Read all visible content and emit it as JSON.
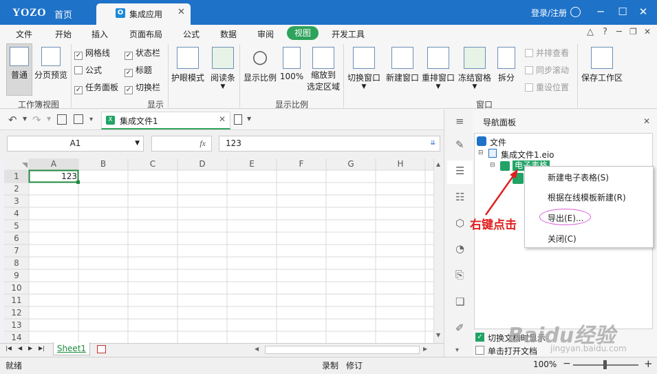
{
  "titlebar": {
    "logo": "YOZO",
    "home": "首页",
    "active_tab": "集成应用",
    "login": "登录/注册"
  },
  "menu": [
    "文件",
    "开始",
    "插入",
    "页面布局",
    "公式",
    "数据",
    "审阅",
    "视图",
    "开发工具"
  ],
  "ribbon": {
    "normal": "普通",
    "page_preview": "分页预览",
    "cb_gridlines": "网格线",
    "cb_formula": "公式",
    "cb_taskpane": "任务面板",
    "cb_statusbar": "状态栏",
    "cb_title": "标题",
    "cb_switch": "切换栏",
    "eye_mode": "护眼模式",
    "reading": "阅读条",
    "zoom": "显示比例",
    "zoom100": "100%",
    "zoom_sel_1": "缩放到",
    "zoom_sel_2": "选定区域",
    "switch_win": "切换窗口",
    "new_win": "新建窗口",
    "arrange": "重排窗口",
    "freeze": "冻结窗格",
    "split": "拆分",
    "side_by_side": "并排查看",
    "sync_scroll": "同步滚动",
    "reset_pos": "重设位置",
    "save_ws": "保存工作区",
    "g_workbook_view": "工作簿视图",
    "g_show": "显示",
    "g_zoom": "显示比例",
    "g_window": "窗口"
  },
  "doc_tab": "集成文件1",
  "formula": {
    "cell_ref": "A1",
    "fx": "fx",
    "value": "123"
  },
  "grid": {
    "columns": [
      "A",
      "B",
      "C",
      "D",
      "E",
      "F",
      "G",
      "H"
    ],
    "rows": [
      "1",
      "2",
      "3",
      "4",
      "5",
      "6",
      "7",
      "8",
      "9",
      "10",
      "11",
      "12",
      "13",
      "14"
    ],
    "a1": "123"
  },
  "sheet_tab": "Sheet1",
  "status": {
    "ready": "就绪",
    "record": "录制",
    "revise": "修订",
    "zoom": "100%"
  },
  "nav": {
    "title": "导航面板",
    "root": "文件",
    "file": "集成文件1.eio",
    "sheet_node": "电子表格",
    "opt_switch": "切换文档时显示",
    "opt_single": "单击打开文档"
  },
  "context_menu": [
    "新建电子表格(S)",
    "根据在线模板新建(R)",
    "导出(E)...",
    "关闭(C)"
  ],
  "annotation": "右键点击",
  "watermark": "Baidu经验",
  "watermark_url": "jingyan.baidu.com",
  "colors": {
    "title_blue": "#1e72c8",
    "view_green": "#2ea35b",
    "annot_red": "#e02020",
    "highlight_ring": "#d85cd8"
  }
}
